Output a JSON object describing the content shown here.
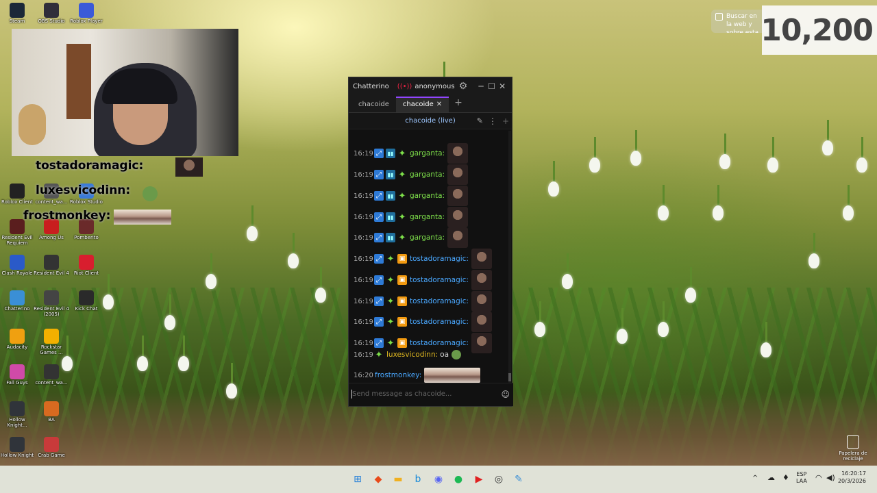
{
  "desktop": {
    "icons_col1": [
      {
        "label": "Steam",
        "icon": "steam-icon",
        "color": "#1b2838"
      },
      {
        "label": "Roblox Client",
        "icon": "roblox-icon",
        "color": "#222222"
      },
      {
        "label": "Resident Evil Requiem",
        "icon": "game-icon",
        "color": "#5a1e1e"
      },
      {
        "label": "Clash Royale",
        "icon": "clash-icon",
        "color": "#2a5ac8"
      },
      {
        "label": "Chatterino",
        "icon": "chatterino-icon",
        "color": "#3a8fd6"
      },
      {
        "label": "Audacity",
        "icon": "audacity-icon",
        "color": "#f0a010"
      },
      {
        "label": "Fall Guys",
        "icon": "fallguys-icon",
        "color": "#d04aa8"
      },
      {
        "label": "Hollow Knight...",
        "icon": "hollowknight-icon",
        "color": "#30343a"
      },
      {
        "label": "Hollow Knight",
        "icon": "hollowknight-icon",
        "color": "#30343a"
      }
    ],
    "icons_col2": [
      {
        "label": "OBS Studio",
        "icon": "obs-icon",
        "color": "#302e3a"
      },
      {
        "label": "content_wa...",
        "icon": "folder-icon",
        "color": "#555555"
      },
      {
        "label": "Among Us",
        "icon": "amongus-icon",
        "color": "#c81e1e"
      },
      {
        "label": "Resident Evil 4",
        "icon": "game-icon",
        "color": "#333333"
      },
      {
        "label": "Resident Evil 4 (2005)",
        "icon": "game-icon",
        "color": "#444444"
      },
      {
        "label": "Rockstar Games ...",
        "icon": "rockstar-icon",
        "color": "#f2b000"
      },
      {
        "label": "content_wa...",
        "icon": "folder-icon",
        "color": "#333333"
      },
      {
        "label": "BA",
        "icon": "game-icon",
        "color": "#d86a20"
      },
      {
        "label": "Crab Game",
        "icon": "crabgame-icon",
        "color": "#c83a3a"
      }
    ],
    "icons_col3": [
      {
        "label": "Roblox Player",
        "icon": "roblox-player-icon",
        "color": "#3a5ad8"
      },
      {
        "label": "Roblox Studio",
        "icon": "roblox-studio-icon",
        "color": "#3a7ad8"
      },
      {
        "label": "Pomberito",
        "icon": "game-icon",
        "color": "#6a2a2a"
      },
      {
        "label": "Riot Client",
        "icon": "riot-icon",
        "color": "#d81e2e"
      },
      {
        "label": "Kick Chat",
        "icon": "kick-icon",
        "color": "#2a2a2a"
      }
    ],
    "recycle_bin": "Papelera de reciclaje"
  },
  "overlay_chat": [
    {
      "name": "tostadoramagic:",
      "color": "#3a8fe8"
    },
    {
      "name": "luxesvicodinn:",
      "color": "#d4b020"
    },
    {
      "name": "frostmonkey:",
      "color": "#3a6ae8"
    }
  ],
  "counter": {
    "value": "10,200"
  },
  "search_tip": {
    "text": "Buscar en la web y sobre esta im"
  },
  "chatterino": {
    "app_title": "Chatterino",
    "user": "anonymous",
    "tabs": [
      {
        "label": "chacoide",
        "active": false
      },
      {
        "label": "chacoide",
        "active": true
      }
    ],
    "split_title": "chacoide (live)",
    "input_placeholder": "Send message as chacoide...",
    "messages": [
      {
        "time": "16:19",
        "user": "garganta:",
        "color": "#7ee04a",
        "badges": [
          "pred",
          "sub",
          "star"
        ],
        "kind": "emote"
      },
      {
        "time": "16:19",
        "user": "garganta:",
        "color": "#7ee04a",
        "badges": [
          "pred",
          "sub",
          "star"
        ],
        "kind": "emote"
      },
      {
        "time": "16:19",
        "user": "garganta:",
        "color": "#7ee04a",
        "badges": [
          "pred",
          "sub",
          "star"
        ],
        "kind": "emote"
      },
      {
        "time": "16:19",
        "user": "garganta:",
        "color": "#7ee04a",
        "badges": [
          "pred",
          "sub",
          "star"
        ],
        "kind": "emote"
      },
      {
        "time": "16:19",
        "user": "garganta:",
        "color": "#7ee04a",
        "badges": [
          "pred",
          "sub",
          "star"
        ],
        "kind": "emote"
      },
      {
        "time": "16:19",
        "user": "tostadoramagic:",
        "color": "#4aa8ff",
        "badges": [
          "pred",
          "star",
          "gift"
        ],
        "kind": "emote"
      },
      {
        "time": "16:19",
        "user": "tostadoramagic:",
        "color": "#4aa8ff",
        "badges": [
          "pred",
          "star",
          "gift"
        ],
        "kind": "emote"
      },
      {
        "time": "16:19",
        "user": "tostadoramagic:",
        "color": "#4aa8ff",
        "badges": [
          "pred",
          "star",
          "gift"
        ],
        "kind": "emote"
      },
      {
        "time": "16:19",
        "user": "tostadoramagic:",
        "color": "#4aa8ff",
        "badges": [
          "pred",
          "star",
          "gift"
        ],
        "kind": "emote"
      },
      {
        "time": "16:19",
        "user": "tostadoramagic:",
        "color": "#4aa8ff",
        "badges": [
          "pred",
          "star",
          "gift"
        ],
        "kind": "emote"
      },
      {
        "time": "16:19",
        "user": "luxesvicodinn:",
        "color": "#e0b820",
        "badges": [
          "star"
        ],
        "kind": "text",
        "text": "oa"
      },
      {
        "time": "16:20",
        "user": "frostmonkey:",
        "color": "#4aa8ff",
        "badges": [],
        "kind": "wide"
      }
    ]
  },
  "taskbar": {
    "apps": [
      {
        "icon": "windows-start-icon",
        "glyph": "⊞",
        "color": "#1a7ad8"
      },
      {
        "icon": "brave-icon",
        "glyph": "◆",
        "color": "#e84a1a"
      },
      {
        "icon": "file-explorer-icon",
        "glyph": "▬",
        "color": "#f0b020"
      },
      {
        "icon": "bing-icon",
        "glyph": "b",
        "color": "#1a8ad8"
      },
      {
        "icon": "discord-icon",
        "glyph": "◉",
        "color": "#5865f2"
      },
      {
        "icon": "spotify-icon",
        "glyph": "●",
        "color": "#1db954"
      },
      {
        "icon": "youtube-icon",
        "glyph": "▶",
        "color": "#e02020"
      },
      {
        "icon": "obs-taskbar-icon",
        "glyph": "◎",
        "color": "#333333"
      },
      {
        "icon": "chatterino-taskbar-icon",
        "glyph": "✎",
        "color": "#3a8fd6"
      }
    ],
    "lang_top": "ESP",
    "lang_bottom": "LAA",
    "time": "16:20:17",
    "date": "20/3/2026"
  }
}
